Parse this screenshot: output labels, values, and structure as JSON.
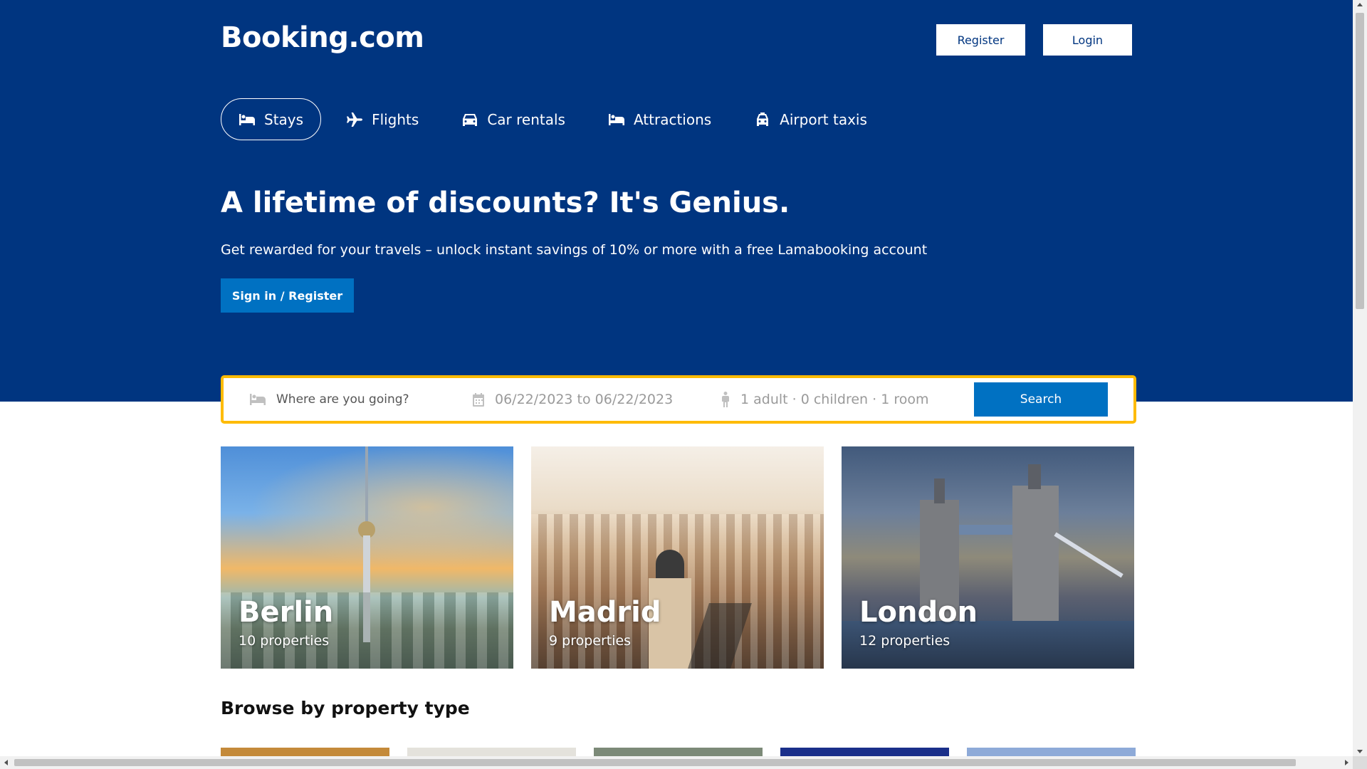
{
  "header": {
    "logo": "Booking.com",
    "register_label": "Register",
    "login_label": "Login"
  },
  "nav": {
    "items": [
      {
        "label": "Stays",
        "icon": "bed-icon",
        "active": true
      },
      {
        "label": "Flights",
        "icon": "plane-icon",
        "active": false
      },
      {
        "label": "Car rentals",
        "icon": "car-icon",
        "active": false
      },
      {
        "label": "Attractions",
        "icon": "bed-icon",
        "active": false
      },
      {
        "label": "Airport taxis",
        "icon": "taxi-icon",
        "active": false
      }
    ]
  },
  "hero": {
    "title": "A lifetime of discounts? It's Genius.",
    "subtitle": "Get rewarded for your travels – unlock instant savings of 10% or more with a free Lamabooking account",
    "cta_label": "Sign in / Register"
  },
  "search": {
    "destination_placeholder": "Where are you going?",
    "dates": "06/22/2023 to 06/22/2023",
    "guests": "1 adult · 0 children · 1 room",
    "button_label": "Search"
  },
  "cities": [
    {
      "name": "Berlin",
      "properties": "10 properties"
    },
    {
      "name": "Madrid",
      "properties": "9 properties"
    },
    {
      "name": "London",
      "properties": "12 properties"
    }
  ],
  "browse": {
    "title": "Browse by property type"
  },
  "colors": {
    "brand_blue": "#003580",
    "action_blue": "#0071c2",
    "search_border": "#febb02"
  }
}
